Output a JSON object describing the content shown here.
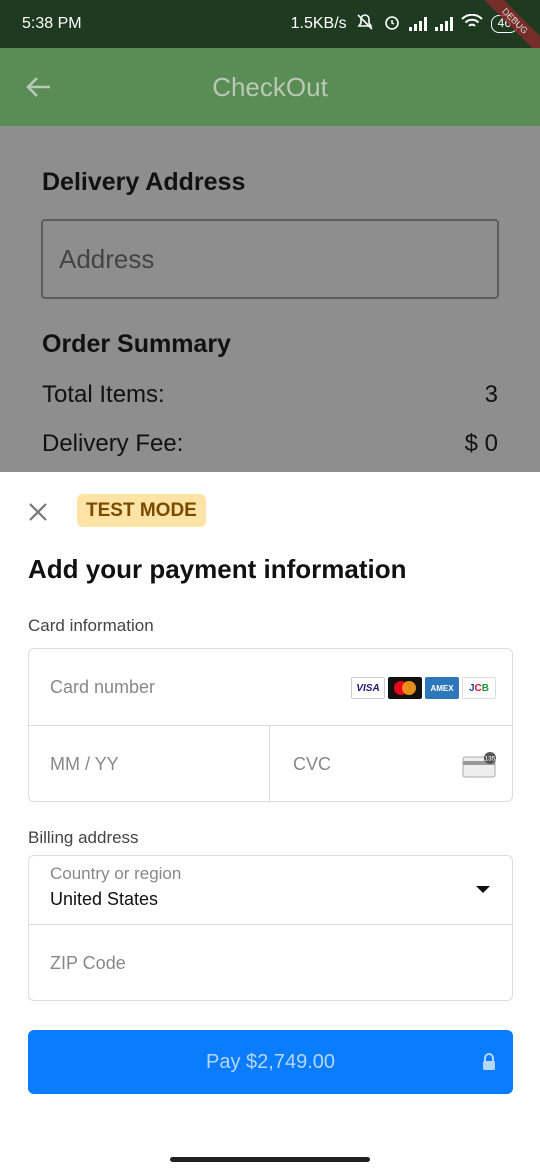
{
  "status_bar": {
    "time": "5:38 PM",
    "speed": "1.5KB/s",
    "battery": "46",
    "debug_label": "DEBUG"
  },
  "app_bar": {
    "title": "CheckOut"
  },
  "page": {
    "delivery_title": "Delivery Address",
    "address_placeholder": "Address",
    "order_summary_title": "Order Summary",
    "total_items_label": "Total Items:",
    "total_items_value": "3",
    "delivery_fee_label": "Delivery Fee:",
    "delivery_fee_value": "$ 0"
  },
  "sheet": {
    "badge": "TEST MODE",
    "title": "Add your payment information",
    "card_info_label": "Card information",
    "card_number_placeholder": "Card number",
    "expiry_placeholder": "MM / YY",
    "cvc_placeholder": "CVC",
    "cvc_icon_text": "135",
    "brands": [
      "VISA",
      "AMEX",
      "JCB"
    ],
    "billing_label": "Billing address",
    "country_label": "Country or region",
    "country_value": "United States",
    "zip_placeholder": "ZIP Code",
    "pay_label": "Pay $2,749.00"
  },
  "colors": {
    "app_bar": "#5a8c56",
    "pay_button": "#0a7cff",
    "badge_bg": "#fde4a6"
  }
}
